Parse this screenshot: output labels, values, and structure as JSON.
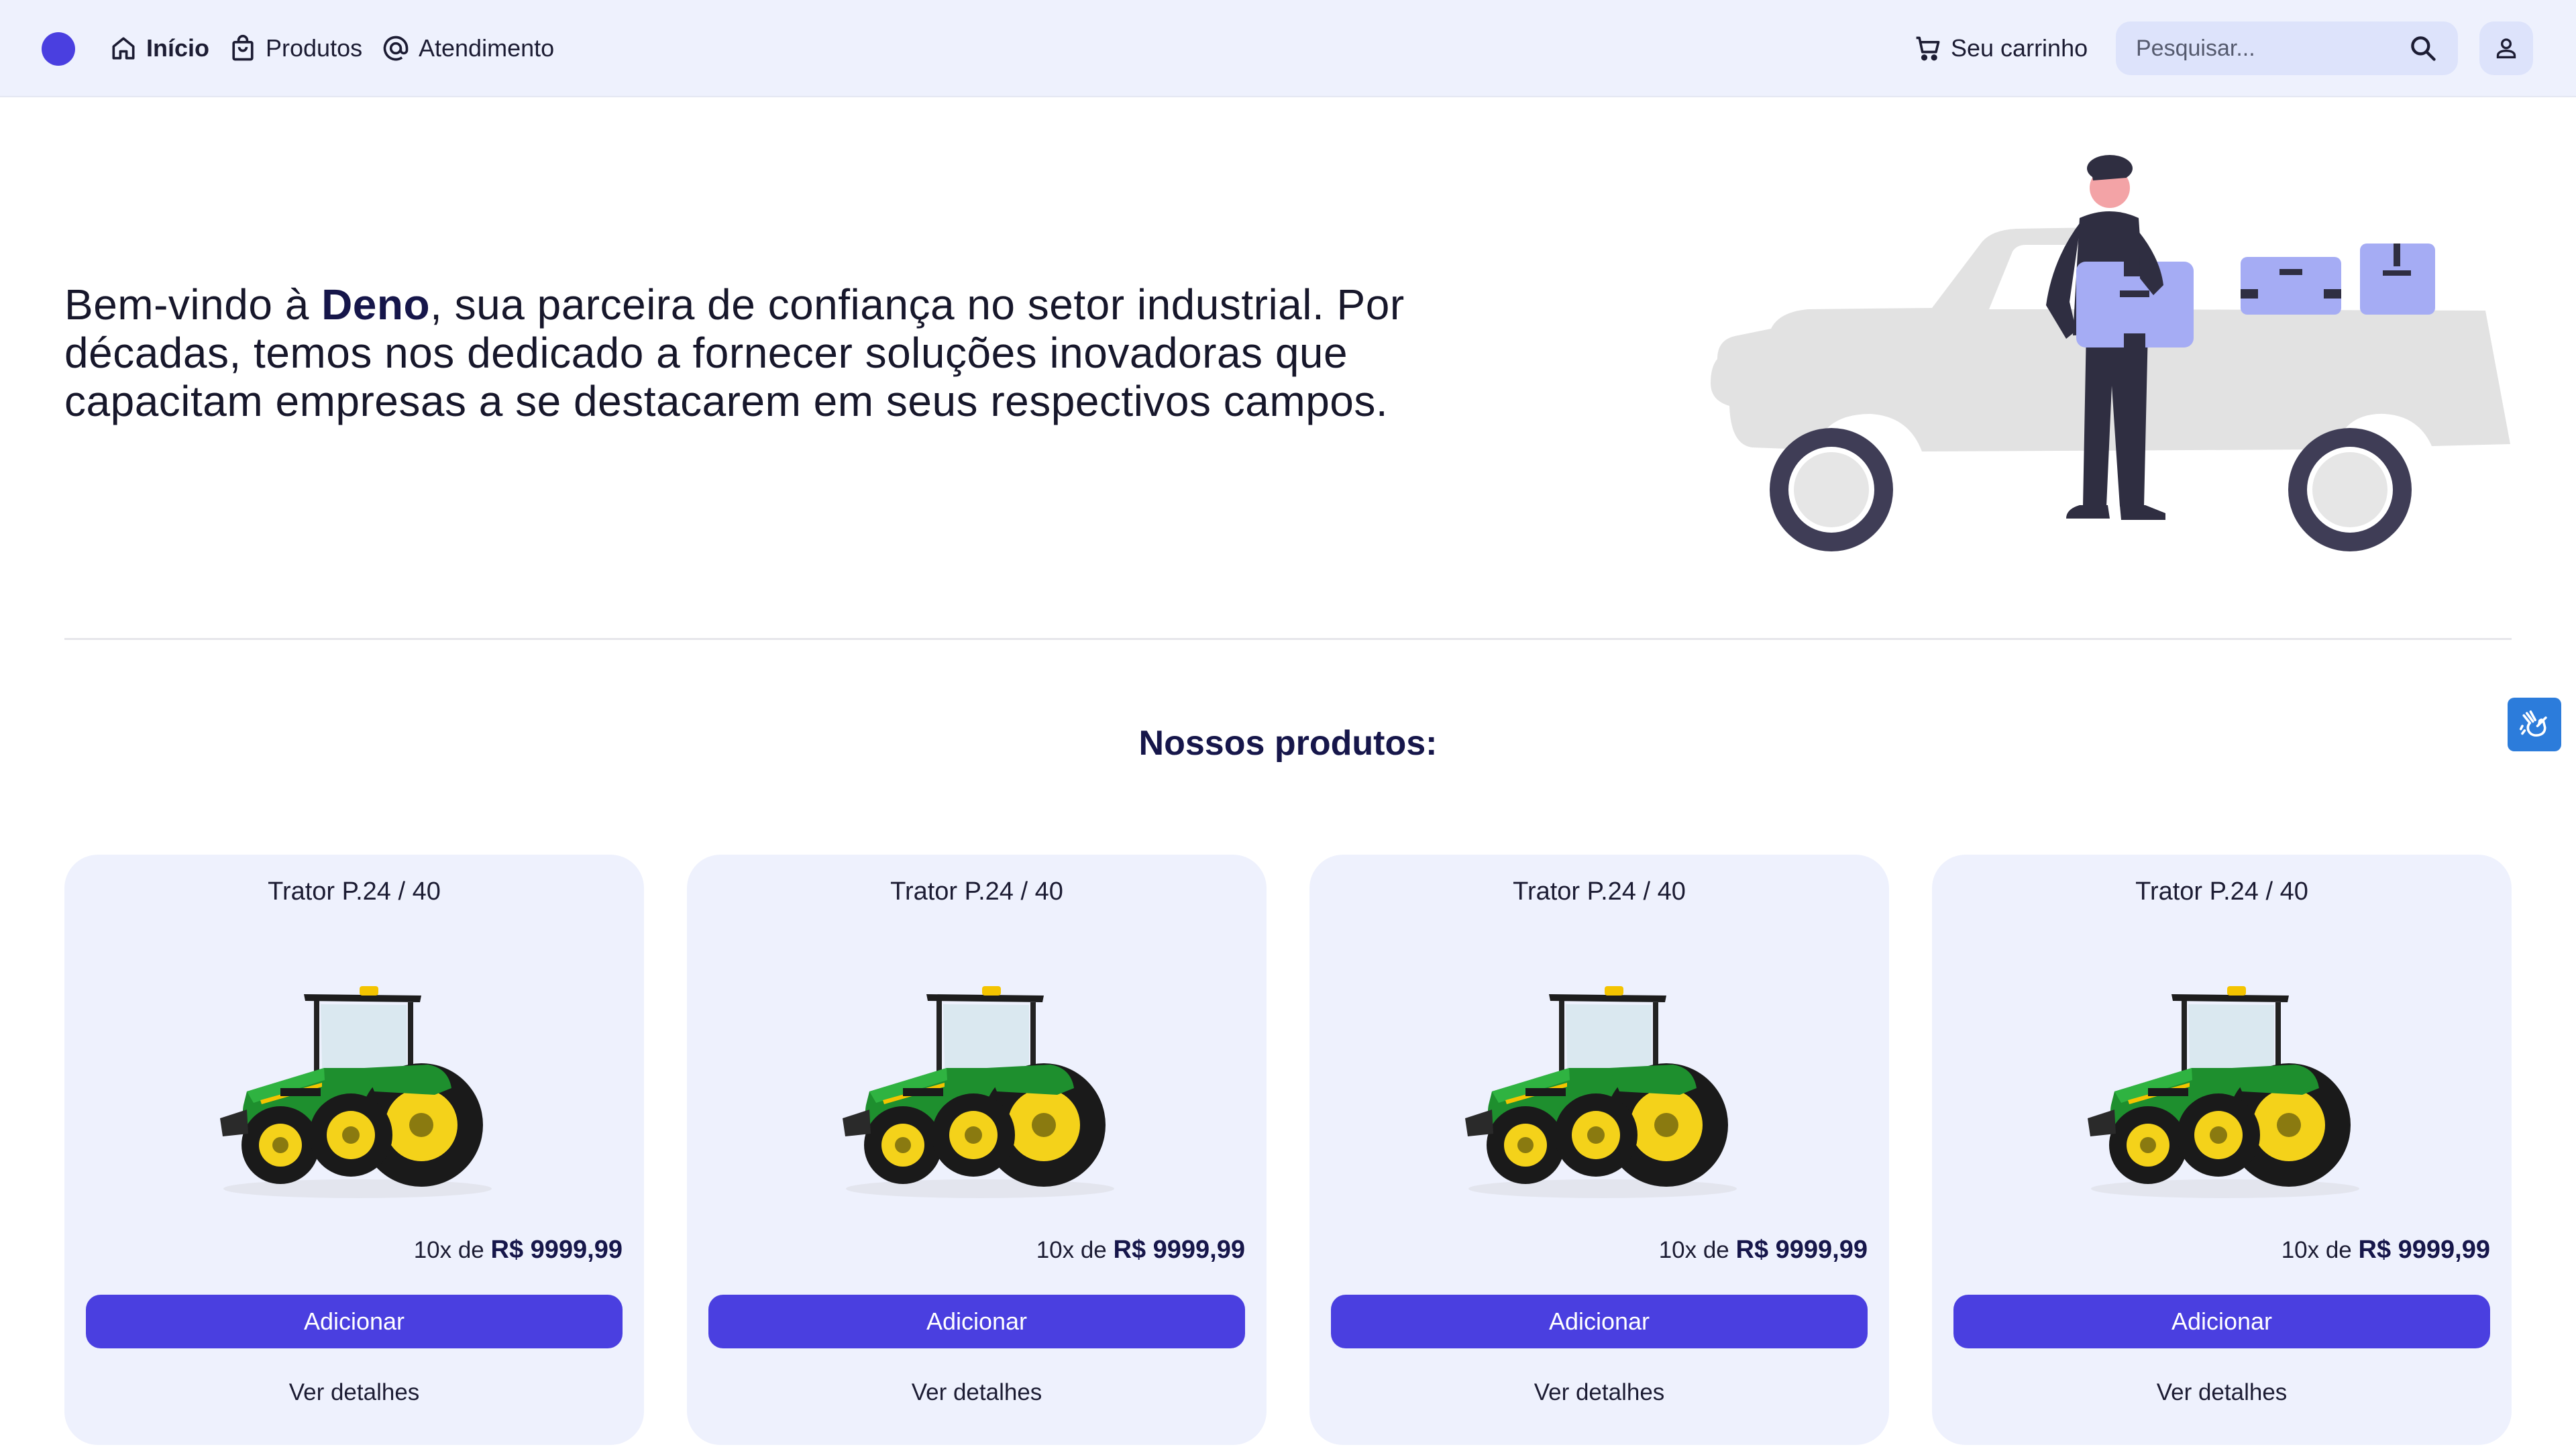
{
  "nav": {
    "home_label": "Início",
    "products_label": "Produtos",
    "support_label": "Atendimento",
    "cart_label": "Seu carrinho",
    "search_placeholder": "Pesquisar..."
  },
  "hero": {
    "text_before": "Bem-vindo à ",
    "brand": "Deno",
    "text_after": ", sua parceira de confiança no setor industrial. Por décadas, temos nos dedicado a fornecer soluções inovadoras que capacitam empresas a se destacarem em seus respectivos campos."
  },
  "products_section": {
    "title": "Nossos produtos:"
  },
  "products": [
    {
      "name": "Trator P.24 / 40",
      "installments": "10x de ",
      "price": "R$ 9999,99",
      "add_label": "Adicionar",
      "details_label": "Ver detalhes"
    },
    {
      "name": "Trator P.24 / 40",
      "installments": "10x de ",
      "price": "R$ 9999,99",
      "add_label": "Adicionar",
      "details_label": "Ver detalhes"
    },
    {
      "name": "Trator P.24 / 40",
      "installments": "10x de ",
      "price": "R$ 9999,99",
      "add_label": "Adicionar",
      "details_label": "Ver detalhes"
    },
    {
      "name": "Trator P.24 / 40",
      "installments": "10x de ",
      "price": "R$ 9999,99",
      "add_label": "Adicionar",
      "details_label": "Ver detalhes"
    }
  ],
  "colors": {
    "accent": "#4a3fe0",
    "nav_background": "#eef1fd",
    "card_background": "#eef1fd",
    "heading": "#16164a",
    "accessibility": "#2c7cdb"
  },
  "icons": {
    "logo": "logo-dot",
    "home": "home-icon",
    "products": "shopping-bag-icon",
    "support": "at-sign-icon",
    "cart": "cart-icon",
    "search": "search-icon",
    "user": "user-icon",
    "accessibility": "sign-language-icon"
  }
}
